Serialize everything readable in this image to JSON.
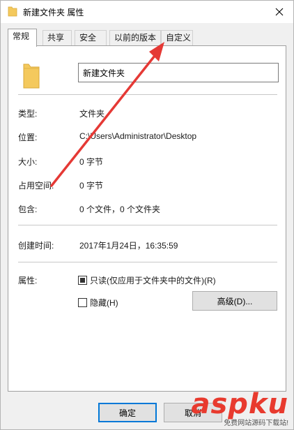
{
  "window": {
    "title": "新建文件夹 属性",
    "accent_color": "#0078d7",
    "folder_color": "#f4c95d"
  },
  "tabs": [
    {
      "label": "常规",
      "active": true
    },
    {
      "label": "共享",
      "active": false
    },
    {
      "label": "安全",
      "active": false
    },
    {
      "label": "以前的版本",
      "active": false
    },
    {
      "label": "自定义",
      "active": false
    }
  ],
  "general": {
    "name": "新建文件夹",
    "type_label": "类型:",
    "type_value": "文件夹",
    "location_label": "位置:",
    "location_value": "C:\\Users\\Administrator\\Desktop",
    "size_label": "大小:",
    "size_value": "0 字节",
    "disk_size_label": "占用空间:",
    "disk_size_value": "0 字节",
    "contains_label": "包含:",
    "contains_value": "0 个文件，0 个文件夹",
    "created_label": "创建时间:",
    "created_value": "2017年1月24日，16:35:59",
    "attributes_label": "属性:",
    "readonly_label": "只读(仅应用于文件夹中的文件)(R)",
    "readonly_state": "indeterminate",
    "hidden_label": "隐藏(H)",
    "hidden_state": "unchecked",
    "advanced_button": "高级(D)..."
  },
  "footer": {
    "ok_button": "确定",
    "cancel_button": "取消"
  },
  "annotation": {
    "arrow_color": "#e53935"
  },
  "watermark": {
    "main": "aspku",
    "sub": "免费网站源码下载站!"
  }
}
